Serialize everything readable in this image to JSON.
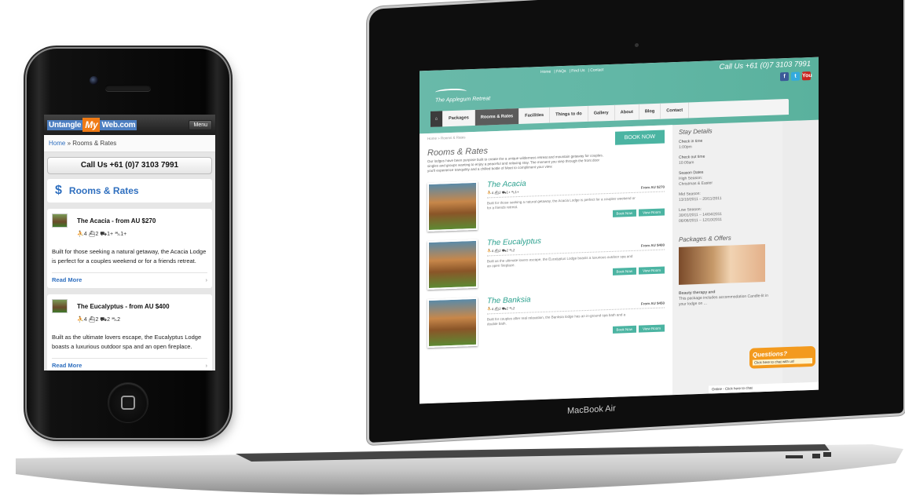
{
  "phone": {
    "logo": {
      "part1": "Untangle",
      "part2": "My",
      "part3": "Web.com"
    },
    "menu_label": "Menu",
    "breadcrumb": {
      "home": "Home",
      "separator": " » ",
      "current": "Rooms & Rates"
    },
    "call_label": "Call Us +61 (0)7 3103 7991",
    "heading_icon": "$",
    "heading": "Rooms & Rates",
    "cards": [
      {
        "title": "The Acacia - from AU $270",
        "amenities": "⛹4  ⛴2  ⛟1+  ⛍1+",
        "description": "Built for those seeking a natural getaway, the Acacia Lodge is perfect for a couples weekend or for a friends retreat.",
        "read_more": "Read More"
      },
      {
        "title": "The Eucalyptus - from AU $400",
        "amenities": "⛹4  ⛴2  ⛟2  ⛍2",
        "description": "Built as the ultimate lovers escape, the Eucalyptus Lodge boasts a luxurious outdoor spa and an open fireplace.",
        "read_more": "Read More"
      }
    ]
  },
  "laptop": {
    "brand": "MacBook Air",
    "site": {
      "top_links": [
        "Home",
        "FAQs",
        "Find Us",
        "Contact"
      ],
      "phone": "Call Us +61 (0)7 3103 7991",
      "social": [
        "f",
        "t",
        "You"
      ],
      "logo_text": "The Applegum Retreat",
      "nav": [
        "⌂",
        "Packages",
        "Rooms & Rates",
        "Facilities",
        "Things to do",
        "Gallery",
        "About",
        "Blog",
        "Contact"
      ],
      "breadcrumb": "Home » Rooms & Rates",
      "book_now": "BOOK NOW",
      "title": "Rooms & Rates",
      "intro": "Our lodges have been purpose built to create the a unique wilderness retreat and mountain getaway for couples, singles and groups wanting to enjoy a peaceful and relaxing stay. The moment you step through the front door you'll experience tranquility and a chilled bottle of Moet to compliment your view.",
      "lodges": [
        {
          "name": "The Acacia",
          "amenities": "⛹4 ⛴2 ⛟1+ ⛍1+",
          "price": "From AU $270",
          "desc": "Built for those seeking a natural getaway, the Acacia Lodge is perfect for a couples weekend or for a friends retreat.",
          "book": "Book Now",
          "view": "View Room"
        },
        {
          "name": "The Eucalyptus",
          "amenities": "⛹4 ⛴2 ⛟2 ⛍2",
          "price": "From AU $400",
          "desc": "Built as the ultimate lovers escape, the Eucalyptus Lodge boasts a luxurious outdoor spa and an open fireplace.",
          "book": "Book Now",
          "view": "View Room"
        },
        {
          "name": "The Banksia",
          "amenities": "⛹4 ⛴2 ⛟2 ⛍2",
          "price": "From AU $450",
          "desc": "Built for couples after real relaxation, the Banksia lodge has an in-ground spa bath and a double bath.",
          "book": "Book Now",
          "view": "View Room"
        }
      ],
      "sidebar": {
        "title": "Stay Details",
        "checkin_label": "Check in time",
        "checkin": "1:00pm",
        "checkout_label": "Check out time",
        "checkout": "10:00am",
        "season_label": "Season Dates",
        "high_label": "High Season:",
        "high": "Christmas & Easter",
        "mid_label": "Mid Season:",
        "mid": "13/10/2011 – 20/11/2011",
        "low_label": "Low Season:",
        "low1": "30/01/2011 – 14/04/2011",
        "low2": "06/06/2011 – 12/10/2011",
        "packages_title": "Packages & Offers",
        "pkg_title": "Beauty therapy and",
        "pkg_desc": "This package includes accommodation Candle-lit in your lodge on ..."
      },
      "chat": {
        "question": "Questions?",
        "cta": "Click here to chat with us!",
        "online": "Online - Click here to chat"
      }
    }
  }
}
